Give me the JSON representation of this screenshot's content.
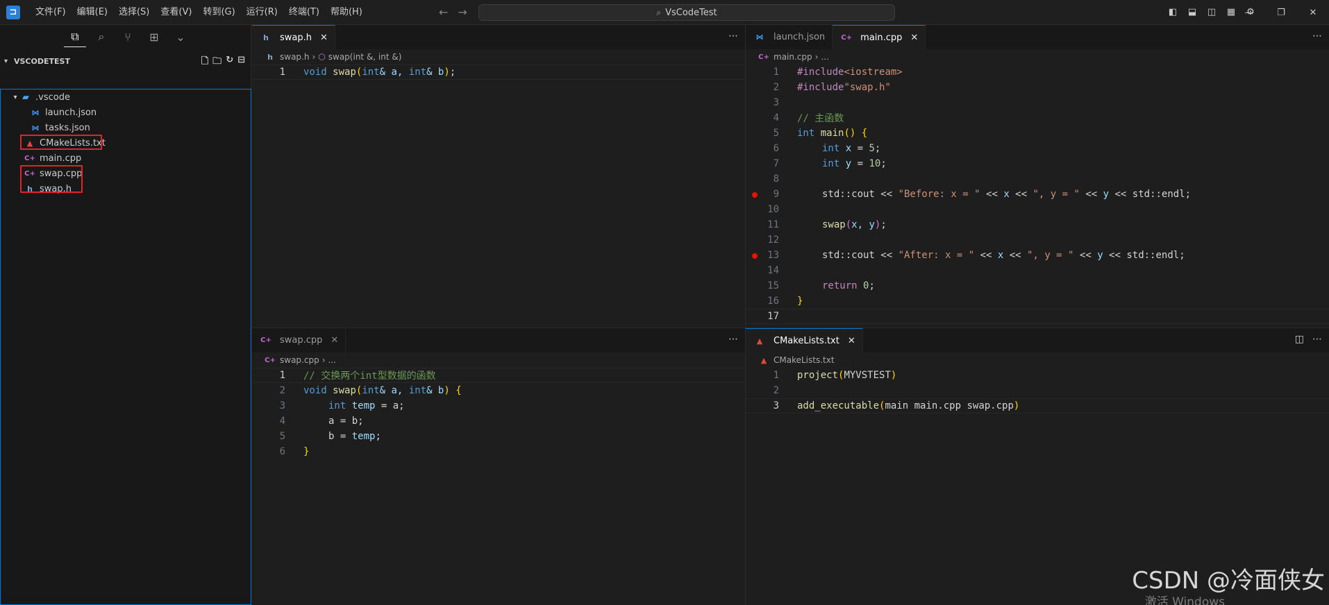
{
  "menu": [
    "文件(F)",
    "编辑(E)",
    "选择(S)",
    "查看(V)",
    "转到(G)",
    "运行(R)",
    "终端(T)",
    "帮助(H)"
  ],
  "command_center": "VsCodeTest",
  "explorer": {
    "title": "VSCODETEST",
    "folder": ".vscode",
    "folder_files": [
      "launch.json",
      "tasks.json"
    ],
    "files": [
      "CMakeLists.txt",
      "main.cpp",
      "swap.cpp",
      "swap.h"
    ]
  },
  "groups": {
    "top_left": {
      "tab": "swap.h",
      "breadcrumb_file": "swap.h",
      "breadcrumb_symbol": "swap(int &, int &)",
      "line_numbers": [
        "1"
      ]
    },
    "top_right": {
      "tabs": [
        "launch.json",
        "main.cpp"
      ],
      "breadcrumb_file": "main.cpp",
      "breadcrumb_rest": "...",
      "line_numbers": [
        "1",
        "2",
        "3",
        "4",
        "5",
        "6",
        "7",
        "8",
        "9",
        "10",
        "11",
        "12",
        "13",
        "14",
        "15",
        "16",
        "17"
      ]
    },
    "bottom_left": {
      "tab": "swap.cpp",
      "breadcrumb_file": "swap.cpp",
      "breadcrumb_rest": "...",
      "line_numbers": [
        "1",
        "2",
        "3",
        "4",
        "5",
        "6"
      ]
    },
    "bottom_right": {
      "tab": "CMakeLists.txt",
      "breadcrumb_file": "CMakeLists.txt",
      "line_numbers": [
        "1",
        "2",
        "3"
      ]
    }
  },
  "code": {
    "swap_h": {
      "l1": {
        "a": "void",
        "b": " ",
        "c": "swap",
        "d": "(",
        "e": "int",
        "f": "& a, ",
        "g": "int",
        "h": "& b",
        "i": ")",
        "j": ";"
      }
    },
    "main_cpp": {
      "l1": {
        "a": "#include",
        "b": "<iostream>"
      },
      "l2": {
        "a": "#include",
        "b": "\"swap.h\""
      },
      "l4": "// 主函数",
      "l5": {
        "a": "int",
        "b": " ",
        "c": "main",
        "d": "()",
        "e": " {"
      },
      "l6": {
        "a": "int",
        "b": " ",
        "c": "x",
        "d": " = ",
        "e": "5",
        "f": ";"
      },
      "l7": {
        "a": "int",
        "b": " ",
        "c": "y",
        "d": " = ",
        "e": "10",
        "f": ";"
      },
      "l9": {
        "a": "std::cout << ",
        "b": "\"Before: x = \"",
        "c": " << ",
        "d": "x",
        "e": " << ",
        "f": "\", y = \"",
        "g": " << ",
        "h": "y",
        "i": " << std::endl;"
      },
      "l11": {
        "a": "swap",
        "b": "(",
        "c": "x, y",
        "d": ")",
        "e": ";"
      },
      "l13": {
        "a": "std::cout << ",
        "b": "\"After: x = \"",
        "c": " << ",
        "d": "x",
        "e": " << ",
        "f": "\", y = \"",
        "g": " << ",
        "h": "y",
        "i": " << std::endl;"
      },
      "l15": {
        "a": "return",
        "b": " ",
        "c": "0",
        "d": ";"
      },
      "l16": "}"
    },
    "swap_cpp": {
      "l1": "// 交换两个int型数据的函数",
      "l2": {
        "a": "void",
        "b": " ",
        "c": "swap",
        "d": "(",
        "e": "int",
        "f": "& a, ",
        "g": "int",
        "h": "& b",
        "i": ")",
        "j": " {"
      },
      "l3": {
        "a": "int",
        "b": " ",
        "c": "temp",
        "d": " = a;"
      },
      "l4": "a = b;",
      "l5": {
        "a": "b = ",
        "b": "temp",
        "c": ";"
      },
      "l6": "}"
    },
    "cmake": {
      "l1": {
        "a": "project",
        "b": "(",
        "c": "MYVSTEST",
        "d": ")"
      },
      "l3": {
        "a": "add_executable",
        "b": "(",
        "c": "main main.cpp swap.cpp",
        "d": ")"
      }
    }
  },
  "watermark": "CSDN @冷面侠女",
  "activate_notice": "激活 Windows"
}
